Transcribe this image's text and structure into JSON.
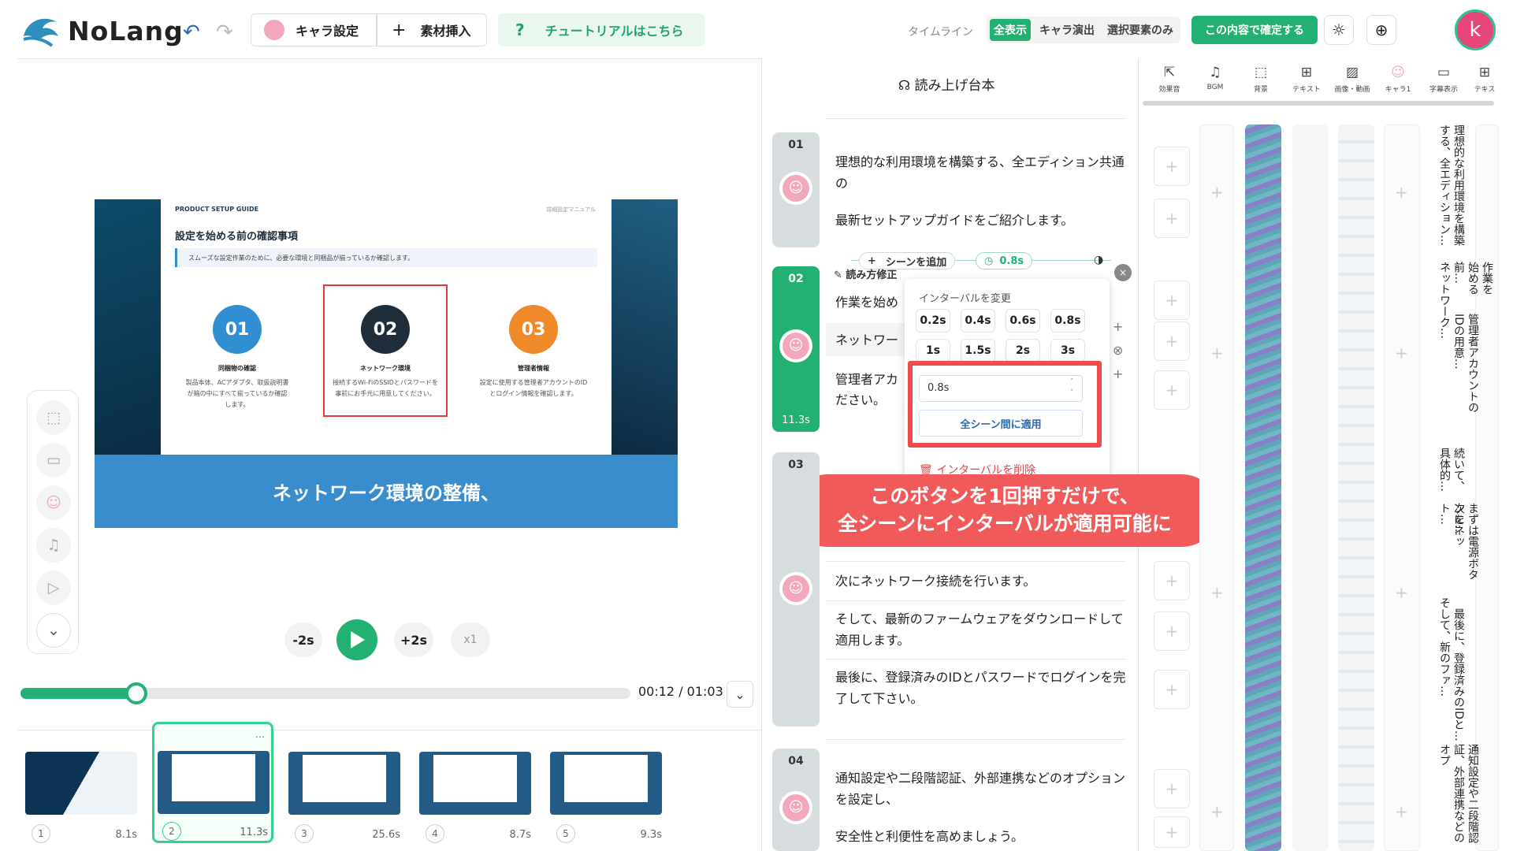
{
  "header": {
    "logo": "NoLang",
    "chara_settings": "キャラ設定",
    "insert_material": "素材挿入",
    "tutorial": "チュートリアルはこちら",
    "timeline_label": "タイムライン",
    "view_modes": [
      "全表示",
      "キャラ演出",
      "選択要素のみ"
    ],
    "confirm": "この内容で確定する",
    "avatar_letter": "k"
  },
  "slide": {
    "tag": "PRODUCT SETUP GUIDE",
    "doc": "詳細設定マニュアル",
    "heading": "設定を始める前の確認事項",
    "sub": "スムーズな設定作業のために、必要な環境と同梱品が揃っているか確認します。",
    "steps": [
      {
        "num": "01",
        "title": "同梱物の確認",
        "desc": "製品本体、ACアダプタ、取扱説明書が箱の中にすべて揃っているか確認します。",
        "color": "#2f8fd0"
      },
      {
        "num": "02",
        "title": "ネットワーク環境",
        "desc": "接続するWi-FiのSSIDとパスワードを事前にお手元に用意してください。",
        "color": "#1f2d3a"
      },
      {
        "num": "03",
        "title": "管理者情報",
        "desc": "設定に使用する管理者アカウントのIDとログイン情報を確認します。",
        "color": "#ee8a2a"
      }
    ],
    "caption": "ネットワーク環境の整備、"
  },
  "player": {
    "back": "-2s",
    "fwd": "+2s",
    "speed": "x1",
    "time": "00:12 / 01:03",
    "progress": 0.19
  },
  "thumbnails": [
    {
      "num": "1",
      "dur": "8.1s"
    },
    {
      "num": "2",
      "dur": "11.3s"
    },
    {
      "num": "3",
      "dur": "25.6s"
    },
    {
      "num": "4",
      "dur": "8.7s"
    },
    {
      "num": "5",
      "dur": "9.3s"
    }
  ],
  "script": {
    "title": "読み上げ台本",
    "scene1": {
      "num": "01",
      "lines": [
        "理想的な利用環境を構築する、全エディション共通の",
        "最新セットアップガイドをご紹介します。"
      ]
    },
    "scene2": {
      "num": "02",
      "dur": "11.3s",
      "lines": [
        "作業を始め",
        "ネットワー",
        "管理者アカ",
        "ださい。"
      ]
    },
    "scene3": {
      "num": "03",
      "lines": [
        "次にネットワーク接続を行います。",
        "そして、最新のファームウェアをダウンロードして適用します。",
        "最後に、登録済みのIDとパスワードでログインを完了して下さい。"
      ]
    },
    "scene4": {
      "num": "04",
      "lines": [
        "通知設定や二段階認証、外部連携などのオプションを設定し、",
        "安全性と利便性を高めましょう。"
      ]
    },
    "edit_reading": "読み方修正",
    "add_scene": "シーンを追加",
    "interval_badge": "0.8s"
  },
  "interval_popup": {
    "title": "インターバルを変更",
    "options": [
      "0.2s",
      "0.4s",
      "0.6s",
      "0.8s",
      "1s",
      "1.5s",
      "2s",
      "3s"
    ],
    "value": "0.8s",
    "apply_all": "全シーン間に適用",
    "delete": "インターバルを削除"
  },
  "callout": {
    "line1": "このボタンを1回押すだけで、",
    "line2": "全シーンにインターバルが適用可能に"
  },
  "timeline": {
    "tracks": [
      "効果音",
      "BGM",
      "背景",
      "テキスト",
      "画像・動画",
      "キャラ1",
      "字幕表示",
      "テキス"
    ],
    "subtitles": [
      "理想的な利用環境を構築する、全エディション…",
      "作業を始める前…",
      "ネットワーク…",
      "管理者アカウントのIDの用意…",
      "続いて、具体的…",
      "まずは電源ボタンを…",
      "次にネット…",
      "そして、新のファ…",
      "最後に、登録済みのIDと…",
      "通知設定や二段階認証、外部連携などのオプ"
    ]
  }
}
